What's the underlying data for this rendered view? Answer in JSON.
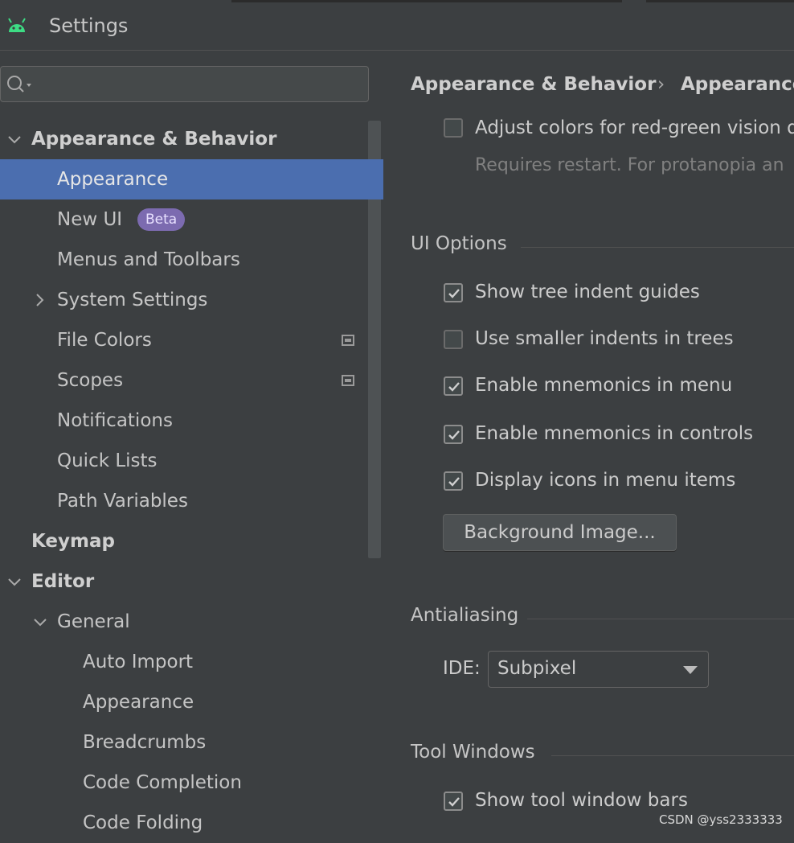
{
  "window": {
    "title": "Settings",
    "icon": "android-icon"
  },
  "search": {
    "placeholder": "",
    "icon": "search-icon"
  },
  "sidebar": {
    "items": [
      {
        "label": "Appearance & Behavior",
        "bold": true,
        "expanded": true
      },
      {
        "label": "Appearance",
        "selected": true
      },
      {
        "label": "New UI",
        "badge": "Beta"
      },
      {
        "label": "Menus and Toolbars"
      },
      {
        "label": "System Settings",
        "collapsed": true
      },
      {
        "label": "File Colors",
        "project_icon": true
      },
      {
        "label": "Scopes",
        "project_icon": true
      },
      {
        "label": "Notifications"
      },
      {
        "label": "Quick Lists"
      },
      {
        "label": "Path Variables"
      },
      {
        "label": "Keymap",
        "bold": true
      },
      {
        "label": "Editor",
        "bold": true,
        "expanded": true
      },
      {
        "label": "General",
        "expanded": true
      },
      {
        "label": "Auto Import"
      },
      {
        "label": "Appearance"
      },
      {
        "label": "Breadcrumbs"
      },
      {
        "label": "Code Completion"
      },
      {
        "label": "Code Folding"
      }
    ]
  },
  "breadcrumb": {
    "first": "Appearance & Behavior",
    "separator": "›",
    "second": "Appearance"
  },
  "accessibility": {
    "adjust_colors": {
      "label": "Adjust colors for red-green vision d",
      "checked": false
    },
    "hint": "Requires restart. For protanopia an"
  },
  "ui_options": {
    "title": "UI Options",
    "options": [
      {
        "label": "Show tree indent guides",
        "checked": true
      },
      {
        "label": "Use smaller indents in trees",
        "checked": false
      },
      {
        "label": "Enable mnemonics in menu",
        "checked": true
      },
      {
        "label": "Enable mnemonics in controls",
        "checked": true
      },
      {
        "label": "Display icons in menu items",
        "checked": true
      }
    ],
    "background_button": "Background Image..."
  },
  "antialiasing": {
    "title": "Antialiasing",
    "ide_label": "IDE:",
    "ide_value": "Subpixel"
  },
  "tool_windows": {
    "title": "Tool Windows",
    "options": [
      {
        "label": "Show tool window bars",
        "checked": true
      }
    ]
  },
  "watermark": "CSDN @yss2333333",
  "colors": {
    "background": "#3c3f41",
    "selection": "#4b6eaf",
    "badge": "#7c6bb0",
    "android_green": "#3ddc84"
  }
}
